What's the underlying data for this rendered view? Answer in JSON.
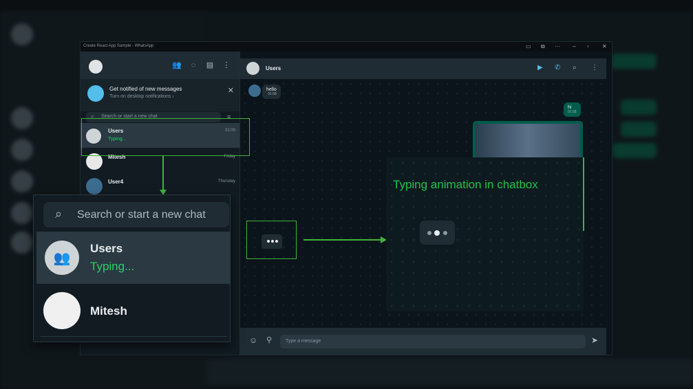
{
  "window": {
    "title": "Create React App Sample - WhatsApp"
  },
  "notification": {
    "title": "Get notified of new messages",
    "subtitle": "Turn on desktop notifications ›"
  },
  "search": {
    "placeholder": "Search or start a new chat"
  },
  "chats": [
    {
      "name": "Users",
      "preview": "Typing...",
      "time": "02:00"
    },
    {
      "name": "Mitesh",
      "preview": "",
      "time": "Friday"
    },
    {
      "name": "User4",
      "preview": "",
      "time": "Thursday"
    }
  ],
  "active_chat": {
    "name": "Users"
  },
  "messages": [
    {
      "text": "hello",
      "time": "01:58",
      "direction": "in"
    },
    {
      "text": "hi",
      "time": "01:58",
      "direction": "out"
    }
  ],
  "composer": {
    "placeholder": "Type a message"
  },
  "zoom": {
    "search_placeholder": "Search or start a new chat",
    "chat1_name": "Users",
    "chat1_preview": "Typing...",
    "chat2_name": "Mitesh",
    "annotation": "Typing animation in chatbox"
  },
  "colors": {
    "accent": "#25d366",
    "highlight": "#3fb43a",
    "outgoing": "#005c4b",
    "panel": "#202c33"
  }
}
